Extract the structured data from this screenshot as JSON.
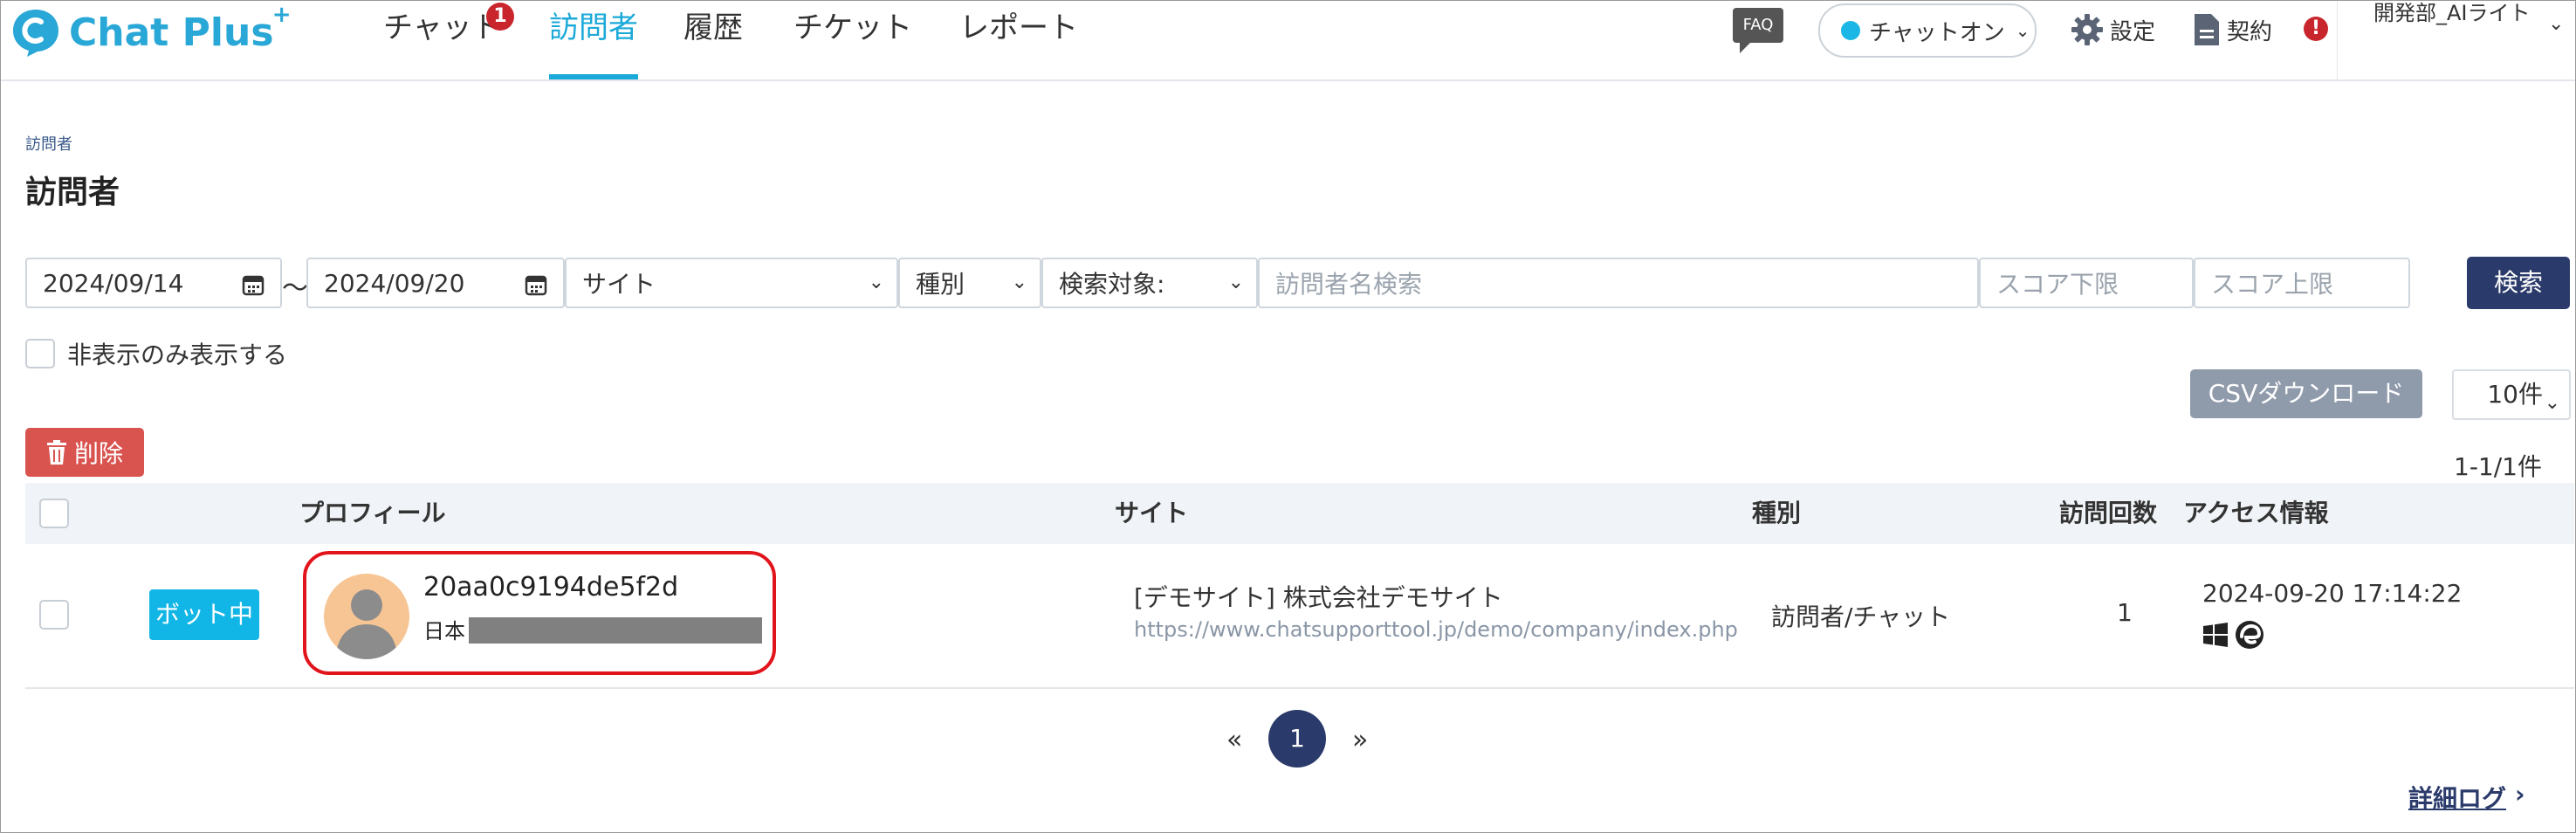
{
  "header": {
    "logo_text": "Chat Plus",
    "logo_sup": "+",
    "nav": [
      {
        "label": "チャット",
        "badge": "1"
      },
      {
        "label": "訪問者"
      },
      {
        "label": "履歴"
      },
      {
        "label": "チケット"
      },
      {
        "label": "レポート"
      }
    ],
    "faq": "FAQ",
    "status": "チャットオン",
    "settings": "設定",
    "contract": "契約",
    "alert": "!",
    "user": "開発部_AIライト"
  },
  "page": {
    "breadcrumb": "訪問者",
    "title": "訪問者"
  },
  "filters": {
    "date_from": "2024/09/14",
    "tilde": "〜",
    "date_to": "2024/09/20",
    "site": "サイト",
    "kind": "種別",
    "target": "検索対象:",
    "name_placeholder": "訪問者名検索",
    "score_min_placeholder": "スコア下限",
    "score_max_placeholder": "スコア上限",
    "search_button": "検索",
    "hidden_only": "非表示のみ表示する"
  },
  "actions": {
    "csv": "CSVダウンロード",
    "per_page": "10件",
    "delete": "削除",
    "count": "1-1/1件"
  },
  "table": {
    "headers": {
      "profile": "プロフィール",
      "site": "サイト",
      "kind": "種別",
      "visits": "訪問回数",
      "access": "アクセス情報"
    },
    "rows": [
      {
        "status": "ボット中",
        "visitor_id": "20aa0c9194de5f2d",
        "country": "日本",
        "site_name": "[デモサイト] 株式会社デモサイト",
        "site_url": "https://www.chatsupporttool.jp/demo/company/index.php",
        "kind": "訪問者/チャット",
        "visits": "1",
        "access_time": "2024-09-20 17:14:22"
      }
    ]
  },
  "pagination": {
    "prev": "«",
    "current": "1",
    "next": "»"
  },
  "footer": {
    "detail_log": "詳細ログ",
    "detail_chev": "›"
  },
  "colors": {
    "brand": "#29a7d6",
    "nav_active": "#1aa9d8",
    "primary_dark": "#2a3a6a",
    "delete": "#d9534f",
    "bot_badge": "#12b6e6",
    "highlight": "#e2141b"
  }
}
